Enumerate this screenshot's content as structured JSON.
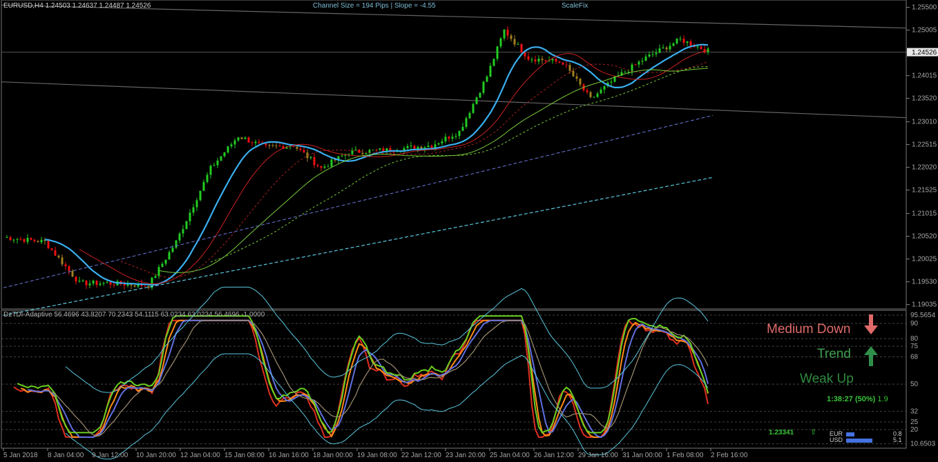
{
  "header": {
    "symbol_line": "EURUSD,H4  1.24503 1.24637 1.24487 1.24526",
    "channel_info": "Channel Size = 194 Pips  |  Slope = -4.55",
    "scalefix": "ScaleFix"
  },
  "price_axis": {
    "labels": [
      "1.25500",
      "1.25005",
      "1.24526",
      "1.24015",
      "1.23520",
      "1.23010",
      "1.22515",
      "1.22020",
      "1.21525",
      "1.21015",
      "1.20520",
      "1.20025",
      "1.19530",
      "1.19035"
    ],
    "current_price": "1.24526"
  },
  "indicator": {
    "title": "DzTDI-Adaptive 56.4696 43.8207 70.2343 54.1115 63.0234 63.0234 56.4696 -1.0000",
    "axis_labels": [
      "95.5654",
      "90",
      "80",
      "75",
      "68",
      "50",
      "32",
      "25",
      "20",
      "10.6503"
    ]
  },
  "time_axis": {
    "labels": [
      "5 Jan 2018",
      "8 Jan 04:00",
      "9 Jan 12:00",
      "10 Jan 20:00",
      "12 Jan 04:00",
      "15 Jan 08:00",
      "16 Jan 16:00",
      "18 Jan 00:00",
      "19 Jan 08:00",
      "22 Jan 12:00",
      "23 Jan 20:00",
      "25 Jan 04:00",
      "26 Jan 12:00",
      "29 Jan 16:00",
      "31 Jan 00:00",
      "1 Feb 08:00",
      "2 Feb 16:00"
    ]
  },
  "signals": {
    "medium": "Medium Down",
    "trend": "Trend",
    "weak": "Weak Up",
    "timer": "1:38:27 (50%)",
    "timer_extra": "1.9",
    "price_green": "1.23341",
    "currencies": [
      {
        "name": "EUR",
        "value": "0.8",
        "strength": 0.16
      },
      {
        "name": "USD",
        "value": "5.1",
        "strength": 0.96
      }
    ]
  },
  "colors": {
    "bull_candle": "#22cc22",
    "bear_candle": "#ee1111",
    "doji_candle": "#a08020",
    "ma_fast": "#3ab0f0",
    "signal_red": "#e06a6a",
    "signal_green": "#3fa050"
  },
  "icons": {
    "medium_arrow": "arrow-down-icon",
    "trend_arrow": "arrow-up-icon",
    "small_arrow": "arrow-up-small-icon"
  }
}
